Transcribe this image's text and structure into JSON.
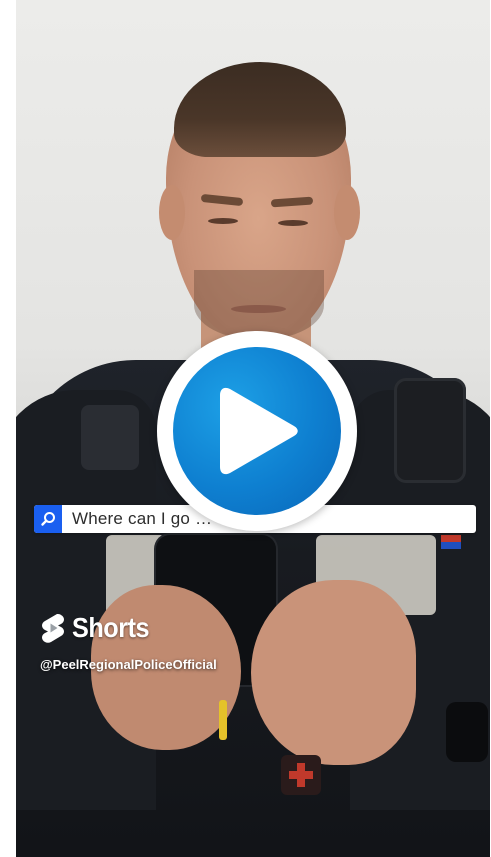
{
  "video": {
    "search_query": "Where can I go … car?",
    "brand_label": "Shorts",
    "channel_handle": "@PeelRegionalPoliceOfficial",
    "colors": {
      "play_blue": "#0e7fd0",
      "search_icon_blue": "#1a5ff0"
    },
    "icons": {
      "play": "play-icon",
      "search": "search-icon",
      "shorts": "youtube-shorts-icon"
    }
  }
}
